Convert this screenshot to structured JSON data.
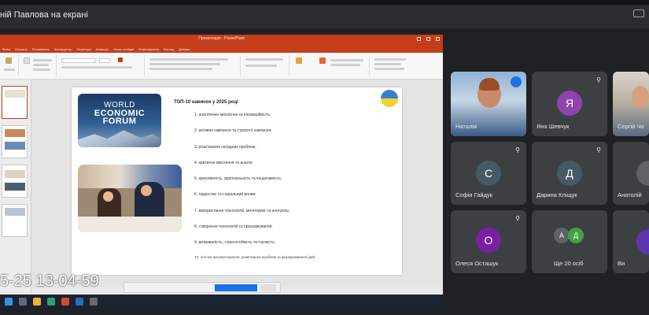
{
  "meeting": {
    "title": "ній Павлова на екрані"
  },
  "ppt": {
    "window_title": "Презентація - PowerPoint",
    "tabs": [
      "Файл",
      "Основне",
      "Вставлення",
      "Конструктор",
      "Переходи",
      "Анімація",
      "Показ слайдів",
      "Рецензування",
      "Вигляд",
      "Довідка"
    ],
    "slide": {
      "wef_logo": [
        "WORLD",
        "ECONOMIC",
        "FORUM"
      ],
      "title": "ТОП-10 навичок у 2025 році",
      "items": [
        "1. аналітичне мислення та інноваційність;",
        "2. активне навчання та стратегії навчання;",
        "3. розв'язання складних проблем;",
        "4. критичне мислення та аналіз;",
        "5. креативність, оригінальність та ініціативність;",
        "6. лідерство та соціальний вплив;",
        "7. використання технологій, моніторинг та контроль;",
        "8. створення технологій та програмування;",
        "9. витривалість, стресостійкість та гнучкість;"
      ],
      "footnote": "10. логічне аргументування, розв'язання проблем та формулювання ідей."
    },
    "timestamp": "5-25 13-04-59"
  },
  "tiles": [
    {
      "name": "Наталія",
      "initial": "",
      "type": "video"
    },
    {
      "name": "Яна Шевчук",
      "initial": "Я",
      "color": "#8e44ad"
    },
    {
      "name": "Сергій Ча",
      "initial": "",
      "type": "video2"
    },
    {
      "name": "Софія Гайдук",
      "initial": "С",
      "color": "#455a64"
    },
    {
      "name": "Дарина Кліщук",
      "initial": "Д",
      "color": "#455a64"
    },
    {
      "name": "Анатолій",
      "initial": "",
      "type": "partial"
    },
    {
      "name": "Олеся Осташук",
      "initial": "О",
      "color": "#7b1fa2"
    },
    {
      "name": "Ще 20 осіб",
      "initial": "",
      "type": "more",
      "avatars": [
        "А",
        "Д"
      ]
    },
    {
      "name": "Ви",
      "initial": "",
      "type": "partial2"
    }
  ]
}
